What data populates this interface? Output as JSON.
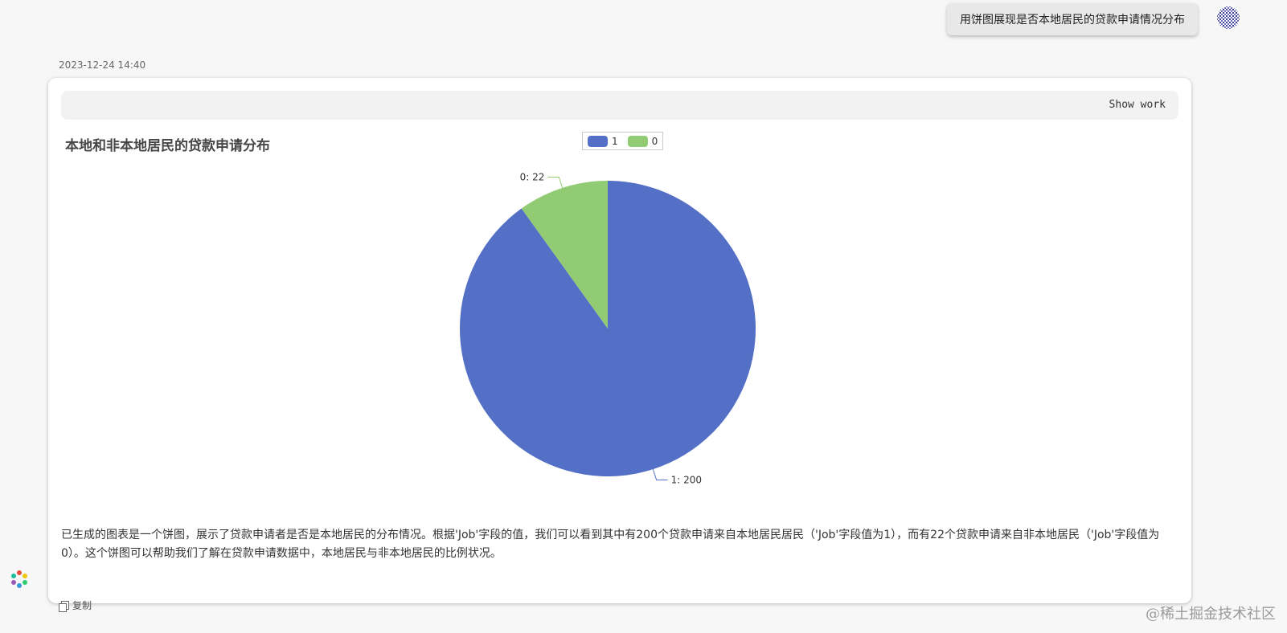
{
  "user_message": "用饼图展现是否本地居民的贷款申请情况分布",
  "timestamp": "2023-12-24 14:40",
  "show_work_label": "Show work",
  "copy_label": "复制",
  "watermark": "@稀土掘金技术社区",
  "summary": "已生成的图表是一个饼图，展示了贷款申请者是否是本地居民的分布情况。根据'Job'字段的值，我们可以看到其中有200个贷款申请来自本地居民居民（'Job'字段值为1），而有22个贷款申请来自非本地居民（'Job'字段值为0）。这个饼图可以帮助我们了解在贷款申请数据中，本地居民与非本地居民的比例状况。",
  "colors": {
    "series_1": "#5470c6",
    "series_0": "#91cc75"
  },
  "chart_data": {
    "type": "pie",
    "title": "本地和非本地居民的贷款申请分布",
    "legend": [
      "1",
      "0"
    ],
    "legend_position": "top-center",
    "slices": [
      {
        "name": "1",
        "value": 200,
        "label": "1: 200"
      },
      {
        "name": "0",
        "value": 22,
        "label": "0: 22"
      }
    ]
  }
}
